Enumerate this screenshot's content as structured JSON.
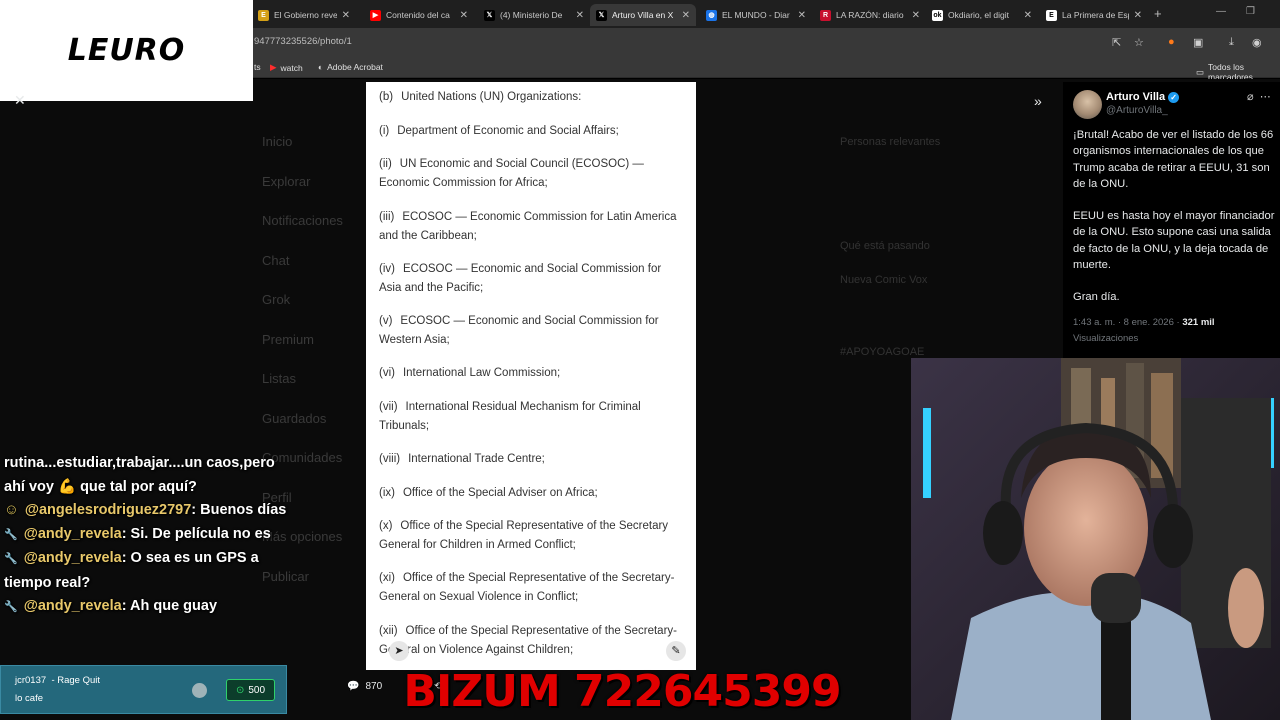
{
  "browser": {
    "tabs": [
      {
        "title": "El Gobierno reve",
        "color": "#d4a017",
        "glyph": "E"
      },
      {
        "title": "Contenido del ca",
        "color": "#ff0000",
        "glyph": "▶"
      },
      {
        "title": "(4) Ministerio De",
        "color": "#000000",
        "glyph": "𝕏"
      },
      {
        "title": "Arturo Villa en X",
        "color": "#000000",
        "glyph": "𝕏",
        "active": true
      },
      {
        "title": "EL MUNDO - Diar",
        "color": "#1a73e8",
        "glyph": "◍"
      },
      {
        "title": "LA RAZÓN: diario",
        "color": "#c8102e",
        "glyph": "R"
      },
      {
        "title": "Okdiario, el digit",
        "color": "#ffffff",
        "glyph": "ok"
      },
      {
        "title": "La Primera de Esp",
        "color": "#ffffff",
        "glyph": "E"
      }
    ],
    "url": "947773235526/photo/1",
    "bookmarks": {
      "item1": "ts",
      "item2": "watch",
      "item3": "Adobe Acrobat",
      "all": "Todos los marcadores"
    }
  },
  "logo": {
    "text": "LEURO"
  },
  "document": {
    "items": [
      {
        "num": "(b)",
        "text": "United Nations (UN) Organizations:"
      },
      {
        "num": "(i)",
        "text": "Department of Economic and Social Affairs;"
      },
      {
        "num": "(ii)",
        "text": "UN Economic and Social Council (ECOSOC) — Economic Commission for Africa;"
      },
      {
        "num": "(iii)",
        "text": "ECOSOC — Economic Commission for Latin America and the Caribbean;"
      },
      {
        "num": "(iv)",
        "text": "ECOSOC — Economic and Social Commission for Asia and the Pacific;"
      },
      {
        "num": "(v)",
        "text": "ECOSOC — Economic and Social Commission for Western Asia;"
      },
      {
        "num": "(vi)",
        "text": "International Law Commission;"
      },
      {
        "num": "(vii)",
        "text": "International Residual Mechanism for Criminal Tribunals;"
      },
      {
        "num": "(viii)",
        "text": "International Trade Centre;"
      },
      {
        "num": "(ix)",
        "text": "Office of the Special Adviser on Africa;"
      },
      {
        "num": "(x)",
        "text": "Office of the Special Representative of the Secretary General for Children in Armed Conflict;"
      },
      {
        "num": "(xi)",
        "text": "Office of the Special Representative of the Secretary-General on Sexual Violence in Conflict;"
      },
      {
        "num": "(xii)",
        "text": "Office of the Special Representative of the Secretary-General on Violence Against Children;"
      }
    ]
  },
  "chat": {
    "messages": [
      {
        "user": "",
        "text": "rutina...estudiar,trabajar....un caos,pero ahí voy 💪 que tal por aquí?"
      },
      {
        "user": "@angelesrodriguez2797",
        "text": ": Buenos días",
        "badge": "☺"
      },
      {
        "user": "@andy_revela",
        "text": ": Si. De película no es",
        "badge": "🔧"
      },
      {
        "user": "@andy_revela",
        "text": ": O sea es un GPS a tiempo real?",
        "badge": "🔧"
      },
      {
        "user": "@andy_revela",
        "text": ": Ah que guay",
        "badge": "🔧"
      }
    ]
  },
  "redeem": {
    "user": "jcr0137",
    "reward": "- Rage Quit",
    "message": "lo cafe",
    "points": "500"
  },
  "stats": {
    "replies": "870"
  },
  "banner": {
    "text": "BIZUM 722645399"
  },
  "tweet": {
    "name": "Arturo Villa",
    "handle": "@ArturoVilla_",
    "paragraphs": [
      "¡Brutal! Acabo de ver el listado de los 66 organismos internacionales de los que Trump acaba de retirar a EEUU, 31 son de la ONU.",
      "EEUU es hasta hoy el mayor financiador de la ONU. Esto supone casi una salida de facto de la ONU, y la deja tocada de muerte.",
      "Gran día."
    ],
    "time": "1:43 a. m. · 8 ene. 2026 ·",
    "views": "321 mil",
    "views_label": "Visualizaciones"
  },
  "background": {
    "nav": [
      "Inicio",
      "Explorar",
      "Notificaciones",
      "Chat",
      "Grok",
      "Premium",
      "Listas",
      "Guardados",
      "Comunidades",
      "Perfil",
      "Más opciones",
      "Publicar"
    ],
    "right": [
      "Personas relevantes",
      "Qué está pasando",
      "Nueva Comic Vox",
      "#APOYOAGOAE"
    ]
  }
}
